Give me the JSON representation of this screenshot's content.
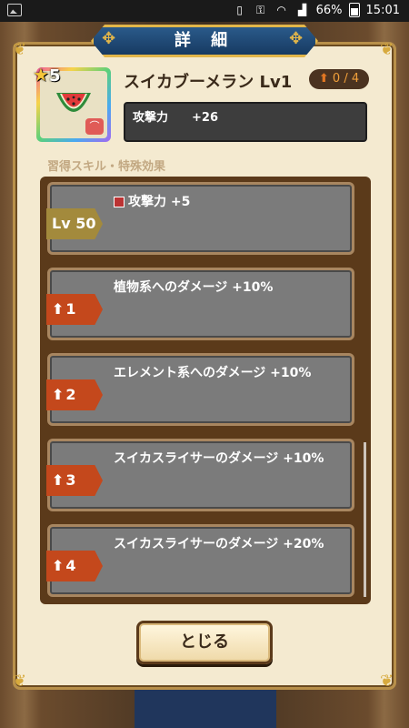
{
  "status_bar": {
    "battery": "66%",
    "time": "15:01",
    "icons": [
      "image-icon",
      "vibrate-icon",
      "key-icon",
      "wifi-icon",
      "signal-icon",
      "battery-icon"
    ]
  },
  "title": "詳 細",
  "item": {
    "stars": "5",
    "name": "スイカブーメラン Lv1",
    "upgrade": "0 / 4",
    "stat_label": "攻撃力",
    "stat_value": "+26"
  },
  "section_label": "習得スキル・特殊効果",
  "skills": [
    {
      "tag": "Lv 50",
      "text": "攻撃力 +5"
    },
    {
      "tag": "1",
      "text": "植物系へのダメージ +10%"
    },
    {
      "tag": "2",
      "text": "エレメント系へのダメージ +10%"
    },
    {
      "tag": "3",
      "text": "スイカスライサーのダメージ +10%"
    },
    {
      "tag": "4",
      "text": "スイカスライサーのダメージ +20%"
    }
  ],
  "close_button": "とじる",
  "colors": {
    "panel": "#f4ead0",
    "title_banner": "#173a62",
    "card": "#7b7b7b",
    "tag_upgrade": "#c4481c",
    "tag_level": "#a38a3c"
  }
}
